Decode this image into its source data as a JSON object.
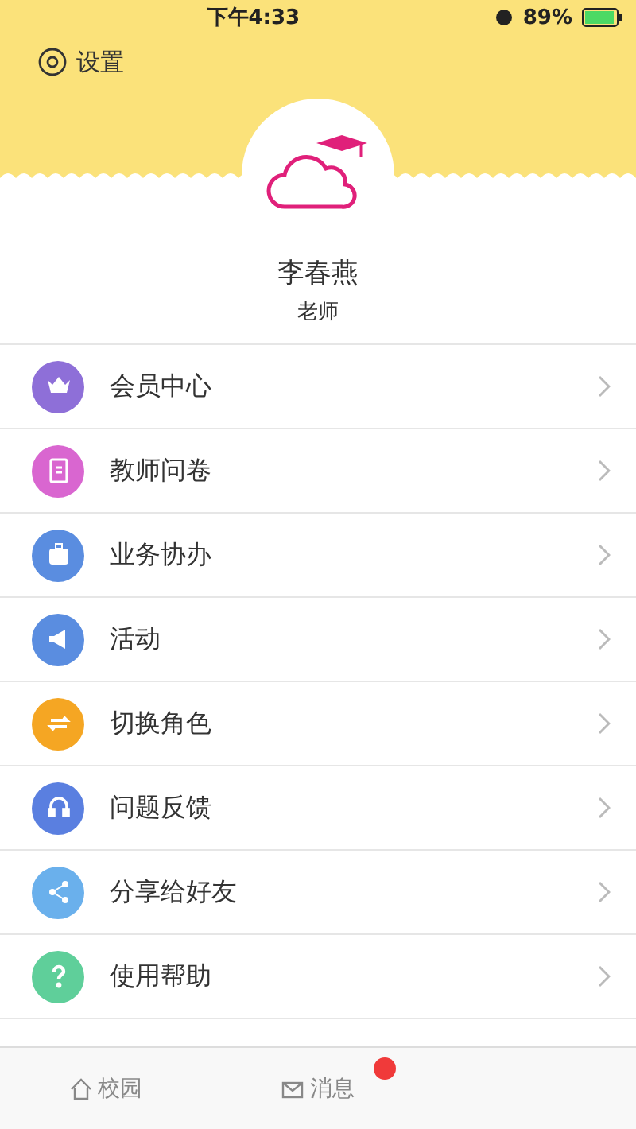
{
  "status_bar": {
    "time": "下午4:33",
    "battery": "89%"
  },
  "header": {
    "settings": "设置"
  },
  "profile": {
    "name": "李春燕",
    "role": "老师"
  },
  "menu": [
    {
      "label": "会员中心",
      "color": "#8e6fd8"
    },
    {
      "label": "教师问卷",
      "color": "#d966d0"
    },
    {
      "label": "业务协办",
      "color": "#5a8de0"
    },
    {
      "label": "活动",
      "color": "#5a8de0"
    },
    {
      "label": "切换角色",
      "color": "#f5a623"
    },
    {
      "label": "问题反馈",
      "color": "#5a7fe0"
    },
    {
      "label": "分享给好友",
      "color": "#6ab0ec"
    },
    {
      "label": "使用帮助",
      "color": "#5fcf9a"
    }
  ],
  "tabs": [
    {
      "label": "校园",
      "selected": false
    },
    {
      "label": "消息",
      "selected": false,
      "badge": true
    }
  ]
}
